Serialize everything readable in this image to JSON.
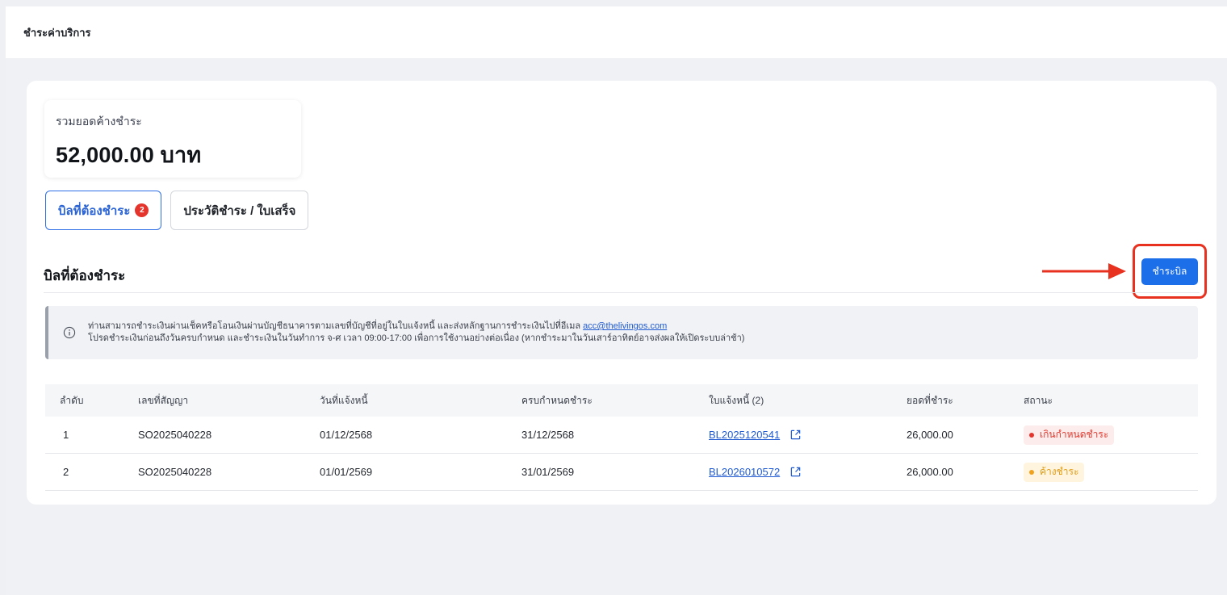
{
  "header": {
    "title": "ชำระค่าบริการ"
  },
  "summary": {
    "label": "รวมยอดค้างชำระ",
    "amount": "52,000.00 บาท"
  },
  "tabs": [
    {
      "label": "บิลที่ต้องชำระ",
      "badge": "2",
      "active": true
    },
    {
      "label": "ประวัติชำระ / ใบเสร็จ",
      "active": false
    }
  ],
  "section": {
    "title": "บิลที่ต้องชำระ",
    "pay_button": "ชำระบิล"
  },
  "notice": {
    "icon": "info-circle-icon",
    "line1_prefix": "ท่านสามารถชำระเงินผ่านเช็คหรือโอนเงินผ่านบัญชีธนาคารตามเลขที่บัญชีที่อยู่ในใบแจ้งหนี้ และส่งหลักฐานการชำระเงินไปที่อีเมล ",
    "email": "acc@thelivingos.com",
    "line2": "โปรดชำระเงินก่อนถึงวันครบกำหนด และชำระเงินในวันทำการ จ-ศ เวลา 09:00-17:00 เพื่อการใช้งานอย่างต่อเนื่อง (หากชำระมาในวันเสาร์อาทิตย์อาจส่งผลให้เปิดระบบล่าช้า)"
  },
  "table": {
    "columns": [
      "ลำดับ",
      "เลขที่สัญญา",
      "วันที่แจ้งหนี้",
      "ครบกำหนดชำระ",
      "ใบแจ้งหนี้ (2)",
      "ยอดที่ชำระ",
      "สถานะ"
    ],
    "rows": [
      {
        "no": "1",
        "contract": "SO2025040228",
        "invoice_date": "01/12/2568",
        "due_date": "31/12/2568",
        "invoice": "BL2025120541",
        "amount": "26,000.00",
        "status": "เกินกำหนดชำระ"
      },
      {
        "no": "2",
        "contract": "SO2025040228",
        "invoice_date": "01/01/2569",
        "due_date": "31/01/2569",
        "invoice": "BL2026010572",
        "amount": "26,000.00",
        "status": "ค้างชำระ"
      }
    ]
  },
  "colors": {
    "accent": "#1c6fe8",
    "highlight": "#e8321f",
    "overdue": "#e03a2f",
    "pending": "#e29b12"
  }
}
